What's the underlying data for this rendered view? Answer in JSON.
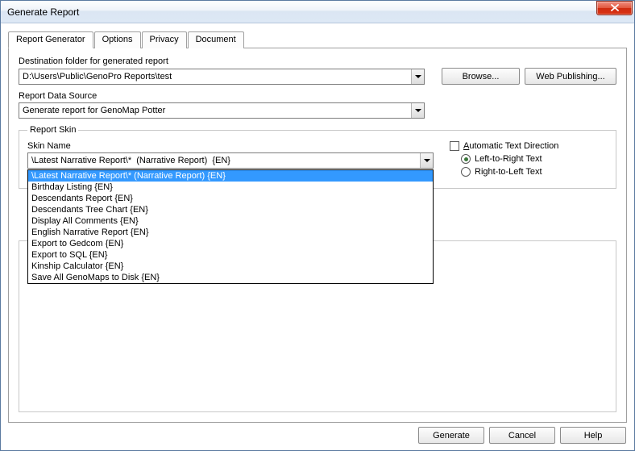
{
  "window": {
    "title": "Generate Report"
  },
  "tabs": [
    "Report Generator",
    "Options",
    "Privacy",
    "Document"
  ],
  "dest": {
    "label": "Destination folder for generated report",
    "value": "D:\\Users\\Public\\GenoPro Reports\\test",
    "browse": "Browse...",
    "webpub": "Web Publishing..."
  },
  "source": {
    "label": "Report Data Source",
    "value": "Generate report for GenoMap Potter"
  },
  "skin": {
    "legend": "Report Skin",
    "label": "Skin Name",
    "value": "\\Latest Narrative Report\\*  (Narrative Report)  {EN}",
    "options": [
      "\\Latest Narrative Report\\*  (Narrative Report)  {EN}",
      "Birthday Listing  {EN}",
      "Descendants Report  {EN}",
      "Descendants Tree Chart  {EN}",
      "Display All Comments  {EN}",
      "English Narrative Report  {EN}",
      "Export to Gedcom  {EN}",
      "Export to SQL  {EN}",
      "Kinship Calculator  {EN}",
      "Save All GenoMaps to Disk  {EN}"
    ],
    "auto_dir": "Automatic Text Direction",
    "ltr": "Left-to-Right Text",
    "rtl": "Right-to-Left Text"
  },
  "footer": {
    "generate": "Generate",
    "cancel": "Cancel",
    "help": "Help"
  }
}
